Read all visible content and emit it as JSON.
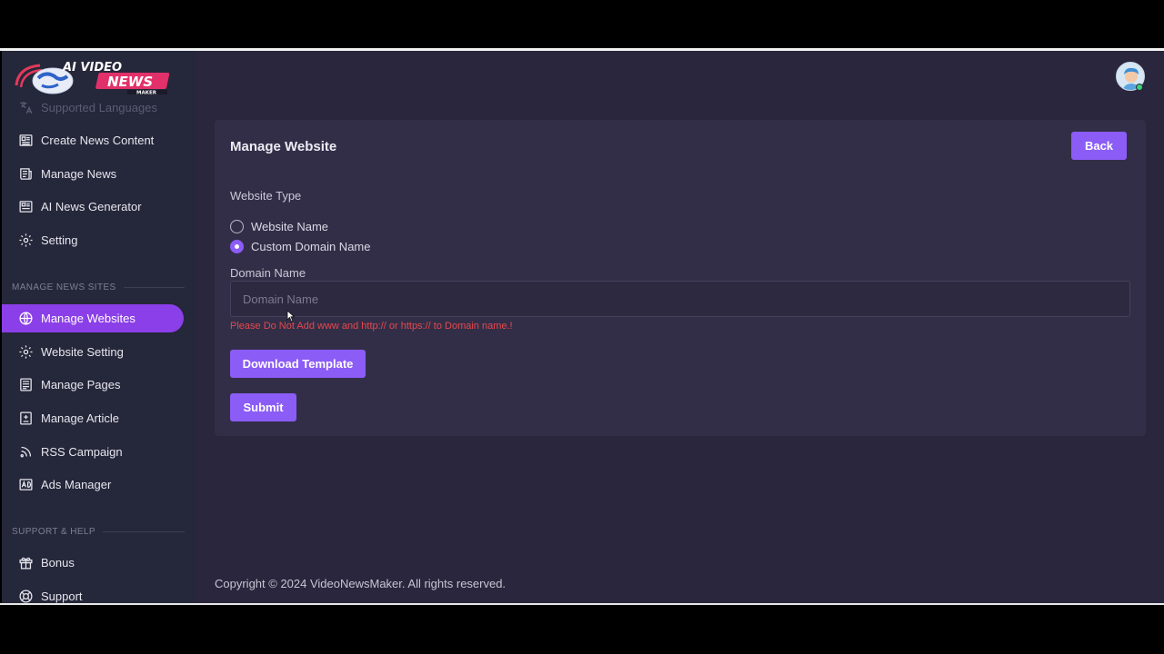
{
  "brand": {
    "line1": "AI VIDEO",
    "line2": "NEWS",
    "line3": "MAKER"
  },
  "sidebar": {
    "items_top": [
      {
        "label": "Supported Languages",
        "icon": "translate-icon",
        "faded": true
      },
      {
        "label": "Create News Content",
        "icon": "newspaper-icon"
      },
      {
        "label": "Manage News",
        "icon": "news-list-icon"
      },
      {
        "label": "AI News Generator",
        "icon": "ai-news-icon"
      },
      {
        "label": "Setting",
        "icon": "gear-icon"
      }
    ],
    "section_sites": "MANAGE NEWS SITES",
    "items_sites": [
      {
        "label": "Manage Websites",
        "icon": "globe-icon",
        "active": true
      },
      {
        "label": "Website Setting",
        "icon": "gear-icon"
      },
      {
        "label": "Manage Pages",
        "icon": "pages-icon"
      },
      {
        "label": "Manage Article",
        "icon": "article-icon"
      },
      {
        "label": "RSS Campaign",
        "icon": "rss-icon"
      },
      {
        "label": "Ads Manager",
        "icon": "ads-icon"
      }
    ],
    "section_support": "SUPPORT & HELP",
    "items_support": [
      {
        "label": "Bonus",
        "icon": "gift-icon"
      },
      {
        "label": "Support",
        "icon": "support-icon"
      }
    ]
  },
  "main": {
    "title": "Manage Website",
    "back_label": "Back",
    "website_type_label": "Website Type",
    "radio_website_name": "Website Name",
    "radio_custom_domain": "Custom Domain Name",
    "selected_type": "Custom Domain Name",
    "domain_label": "Domain Name",
    "domain_placeholder": "Domain Name",
    "domain_value": "",
    "error_text": "Please Do Not Add www and http:// or https:// to Domain name.!",
    "download_label": "Download Template",
    "submit_label": "Submit"
  },
  "footer": {
    "copyright": "Copyright © 2024 VideoNewsMaker. All rights reserved."
  },
  "colors": {
    "accent": "#8b5cf6",
    "active_nav": "#8b3fe8",
    "error": "#e5484d",
    "background": "#2a263d",
    "sidebar": "#25273a"
  }
}
